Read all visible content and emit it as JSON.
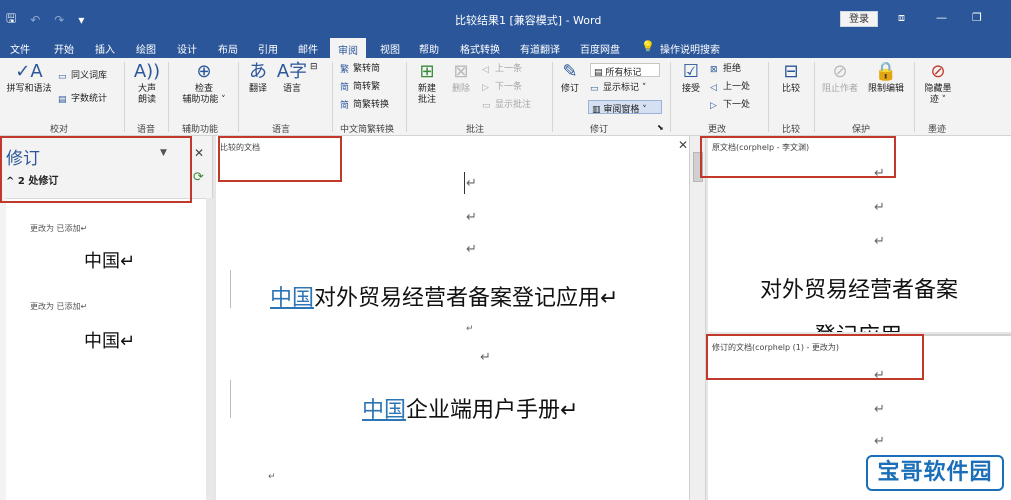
{
  "window": {
    "title": "比较结果1 [兼容模式] - Word",
    "login_label": "登录",
    "controls": {
      "ribbon_display": "⧈",
      "minimize": "—",
      "restore": "❐"
    }
  },
  "quick_access": {
    "save": "🖫",
    "undo": "↶",
    "redo": "↷",
    "customize": "▾"
  },
  "tabs": [
    "文件",
    "开始",
    "插入",
    "绘图",
    "设计",
    "布局",
    "引用",
    "邮件",
    "审阅",
    "视图",
    "帮助",
    "格式转换",
    "有道翻译",
    "百度网盘"
  ],
  "active_tab": "审阅",
  "tell_me": "操作说明搜索",
  "ribbon": {
    "proofing": {
      "label": "校对",
      "spelling": "拼写和语法",
      "thesaurus": "同义词库",
      "word_count": "字数统计"
    },
    "speech": {
      "label": "语音",
      "read_aloud_1": "大声",
      "read_aloud_2": "朗读"
    },
    "accessibility": {
      "label": "辅助功能",
      "check_1": "检查",
      "check_2": "辅助功能 ˅"
    },
    "language": {
      "label": "语言",
      "translate": "翻译",
      "language": "语言"
    },
    "chinese": {
      "label": "中文简繁转换",
      "to_simplified": "繁转简",
      "to_traditional": "简转繁",
      "convert": "简繁转换"
    },
    "comments": {
      "label": "批注",
      "new_1": "新建",
      "new_2": "批注",
      "delete": "删除",
      "previous": "上一条",
      "next": "下一条",
      "show": "显示批注"
    },
    "tracking": {
      "label": "修订",
      "track": "修订",
      "markup_combo": "所有标记",
      "show_markup": "显示标记 ˅",
      "pane": "审阅窗格 ˅"
    },
    "changes": {
      "label": "更改",
      "accept": "接受",
      "reject": "拒绝",
      "previous": "上一处",
      "next": "下一处"
    },
    "compare": {
      "label": "比较",
      "compare": "比较"
    },
    "protect": {
      "label": "保护",
      "block_authors": "阻止作者",
      "restrict": "限制编辑"
    },
    "ink": {
      "label": "墨迹",
      "hide_1": "隐藏墨",
      "hide_2": "迹 ˅"
    }
  },
  "revisions_pane": {
    "title": "修订",
    "count": "2 处修订",
    "items": [
      {
        "meta": "更改为 已添加↵",
        "word": "中国↵"
      },
      {
        "meta": "更改为 已添加↵",
        "word": "中国↵"
      }
    ]
  },
  "compared_doc": {
    "label": "比较的文档",
    "para_mark": "↵",
    "line1_inserted": "中国",
    "line1_rest": "对外贸易经营者备案登记应用↵",
    "line2_inserted": "中国",
    "line2_rest": "企业端用户手册↵"
  },
  "original_doc": {
    "label": "原文档(corphelp - 李文渊)",
    "para_mark": "↵",
    "line1": "对外贸易经营者备案",
    "line2": "登记应用"
  },
  "revised_doc": {
    "label": "修订的文档(corphelp (1) - 更改为)",
    "para_mark": "↵"
  },
  "watermark": "宝哥软件园",
  "colors": {
    "accent": "#2b579a",
    "insert": "#2e75b6",
    "highlight_box": "#c0392b",
    "watermark": "#1a6fb8"
  }
}
